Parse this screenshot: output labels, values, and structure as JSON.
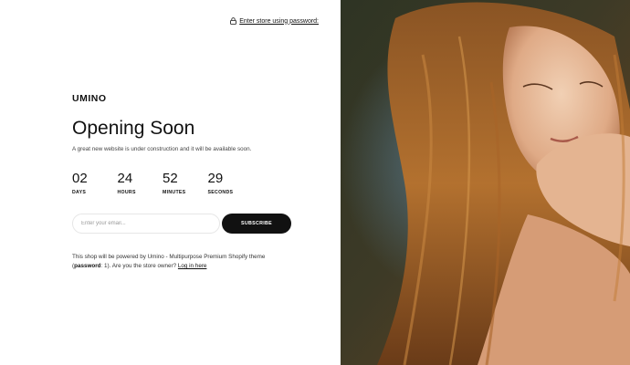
{
  "header": {
    "password_link": "Enter store using password:",
    "lock_icon": "lock-icon"
  },
  "brand": {
    "logo": "UMINO"
  },
  "main": {
    "title": "Opening Soon",
    "subtitle": "A great new website is under construction and it will be available soon."
  },
  "countdown": [
    {
      "value": "02",
      "label": "DAYS"
    },
    {
      "value": "24",
      "label": "HOURS"
    },
    {
      "value": "52",
      "label": "MINUTES"
    },
    {
      "value": "29",
      "label": "SECONDS"
    }
  ],
  "newsletter": {
    "email_placeholder": "Enter your email...",
    "email_value": "",
    "subscribe_label": "SUBSCRIBE"
  },
  "footer": {
    "line1": "This shop will be powered by Umino - Multipurpose Premium Shopify theme",
    "password_label": "password",
    "password_value": ": 1",
    "owner_text": ".  Are you the store owner?",
    "login_link": "Log in here"
  },
  "colors": {
    "accent": "#111111",
    "background": "#ffffff",
    "input_border": "#e6e6e6"
  }
}
